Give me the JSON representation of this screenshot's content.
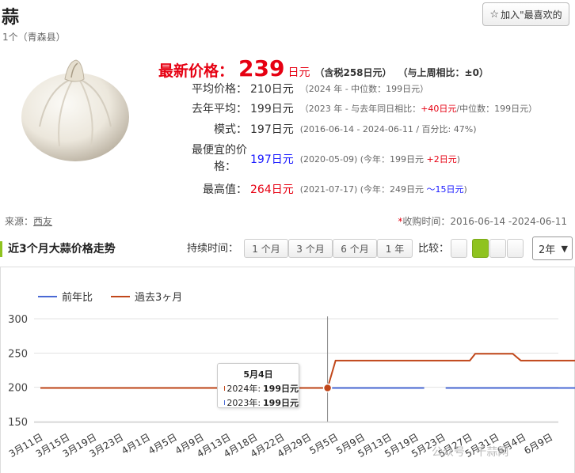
{
  "product": {
    "title": "蒜",
    "subtitle": "1个（青森县）"
  },
  "favorite": {
    "icon": "star-outline-icon",
    "label": "加入\"最喜欢的"
  },
  "latest": {
    "label": "最新价格：",
    "price": "239",
    "unit": "日元",
    "tax": "（含税258日元）",
    "compare": "（与上周相比：±0）"
  },
  "stats": [
    {
      "key": "平均价格：",
      "value": "210日元",
      "note": "（2024 年 - 中位数：199日元）"
    },
    {
      "key": "去年平均：",
      "value": "199日元",
      "note_a": "（2023 年 - 与去年同日相比：",
      "note_b": "+40日元",
      "note_c": "/中位数：199日元）"
    },
    {
      "key": "模式：",
      "value": "197日元",
      "note": "(2016-06-14 - 2024-06-11 / 百分比: 47%)"
    },
    {
      "key_a": "最便宜的价",
      "key_b": "格：",
      "value": "197日元",
      "note_a": "(2020-05-09) (今年：199日元 ",
      "note_b": "+2日元",
      "note_c": ")"
    },
    {
      "key": "最高值：",
      "value": "264日元",
      "note_a": "(2021-07-17) (今年：249日元 ",
      "note_b": "～15日元",
      "note_c": ")"
    }
  ],
  "source": {
    "label": "来源：",
    "link": "西友"
  },
  "period": {
    "asterisk": "*",
    "text": "收购时间：2016-06-14 -2024-06-11"
  },
  "section": {
    "title": "近3个月大蒜价格走势"
  },
  "controls": {
    "duration_label": "持续时间：",
    "durations": [
      "1 个月",
      "3 个月",
      "6 个月",
      "1 年"
    ],
    "compare_label": "比较：",
    "year_selected": "2年"
  },
  "tooltip": {
    "date": "5月4日",
    "row1_label": "2024年:",
    "row1_value": "199日元",
    "row2_label": "2023年:",
    "row2_value": "199日元"
  },
  "watermark": "公众号 · 千蒜网",
  "colors": {
    "accent_green": "#8fc31f",
    "price_red": "#e60012",
    "series_prev": "#4a69d4",
    "series_recent": "#c1471a"
  },
  "chart_data": {
    "type": "line",
    "legend": [
      "前年比",
      "過去3ヶ月"
    ],
    "legend_position": "top-left",
    "ylim": [
      150,
      300
    ],
    "yticks": [
      150,
      200,
      250,
      300
    ],
    "grid": true,
    "x_labels": [
      "3月11日",
      "3月15日",
      "3月19日",
      "3月23日",
      "4月1日",
      "4月5日",
      "4月9日",
      "4月13日",
      "4月18日",
      "4月22日",
      "4月29日",
      "5月5日",
      "5月9日",
      "5月13日",
      "5月19日",
      "5月23日",
      "5月27日",
      "5月31日",
      "6月4日",
      "6月9日"
    ],
    "hover_index": 10.7,
    "series": [
      {
        "name": "前年比",
        "points": [
          [
            0,
            199
          ],
          [
            14.3,
            199
          ],
          [
            15.1,
            null
          ],
          [
            15.1,
            199
          ],
          [
            20,
            199
          ]
        ]
      },
      {
        "name": "過去3ヶ月",
        "points": [
          [
            0,
            199
          ],
          [
            10.7,
            199
          ],
          [
            11.0,
            239
          ],
          [
            16.0,
            239
          ],
          [
            16.2,
            249
          ],
          [
            17.6,
            249
          ],
          [
            17.9,
            239
          ],
          [
            20,
            239
          ]
        ]
      }
    ]
  }
}
